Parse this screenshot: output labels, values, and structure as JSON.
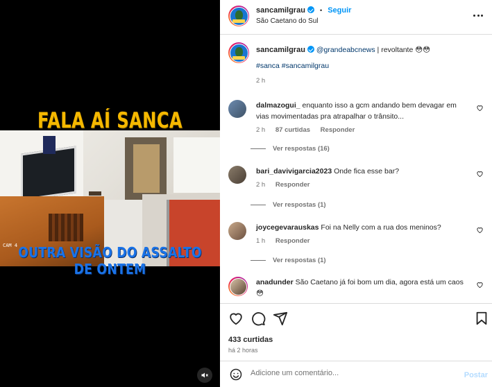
{
  "media": {
    "headline": "FALA AÍ SANCA",
    "caption": "OUTRA VISÃO DO ASSALTO DE ONTEM",
    "cam_label": "CAM 4",
    "mute_icon": "speaker-muted-icon"
  },
  "header": {
    "username": "sancamilgrau",
    "separator": "•",
    "follow_label": "Seguir",
    "location": "São Caetano do Sul"
  },
  "post": {
    "username": "sancamilgrau",
    "mention": "@grandeabcnews",
    "text": " | revoltante 😳😳",
    "hashtags": "#sanca #sancamilgrau",
    "time": "2 h"
  },
  "comments": [
    {
      "username": "dalmazogui_",
      "text": "enquanto isso a gcm andando bem devagar em vias movimentadas pra atrapalhar o trânsito...",
      "time": "2 h",
      "likes": "87 curtidas",
      "reply_label": "Responder",
      "view_replies": "Ver respostas (16)"
    },
    {
      "username": "bari_davivigarcia2023",
      "text": "Onde fica esse bar?",
      "time": "2 h",
      "reply_label": "Responder",
      "view_replies": "Ver respostas (1)"
    },
    {
      "username": "joycegevarauskas",
      "text": "Foi na Nelly com a rua dos meninos?",
      "time": "1 h",
      "reply_label": "Responder",
      "view_replies": "Ver respostas (1)"
    },
    {
      "username": "anadunder",
      "text": "São Caetano já foi bom um dia, agora está um caos 😳",
      "time": "",
      "reply_label": ""
    }
  ],
  "actions": {
    "likes": "433 curtidas",
    "time_ago": "há 2 horas"
  },
  "add_comment": {
    "placeholder": "Adicione um comentário...",
    "post_label": "Postar"
  },
  "colors": {
    "accent": "#0095f6",
    "headline": "#f5b800",
    "caption": "#1a73e8",
    "muted": "#737373"
  }
}
